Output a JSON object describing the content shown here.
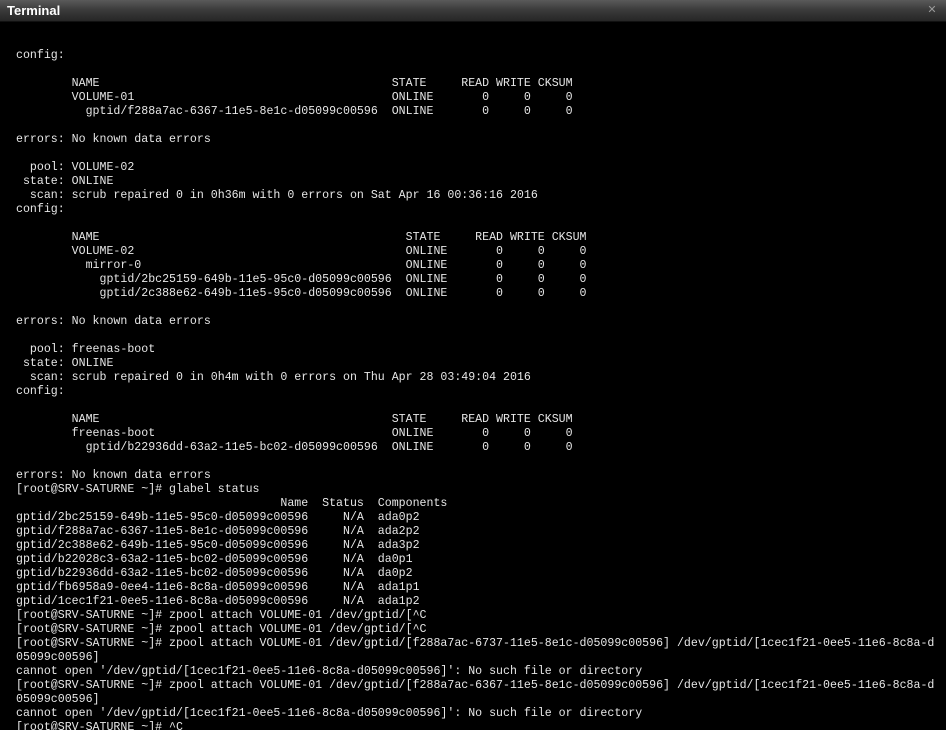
{
  "window": {
    "title": "Terminal",
    "close_icon": "close-icon",
    "colors": {
      "background": "#000000",
      "text": "#e6e6e6",
      "titlebar": "#3c3c3c"
    }
  },
  "terminal": {
    "lines": [
      "config:",
      "",
      "        NAME                                          STATE     READ WRITE CKSUM",
      "        VOLUME-01                                     ONLINE       0     0     0",
      "          gptid/f288a7ac-6367-11e5-8e1c-d05099c00596  ONLINE       0     0     0",
      "",
      "errors: No known data errors",
      "",
      "  pool: VOLUME-02",
      " state: ONLINE",
      "  scan: scrub repaired 0 in 0h36m with 0 errors on Sat Apr 16 00:36:16 2016",
      "config:",
      "",
      "        NAME                                            STATE     READ WRITE CKSUM",
      "        VOLUME-02                                       ONLINE       0     0     0",
      "          mirror-0                                      ONLINE       0     0     0",
      "            gptid/2bc25159-649b-11e5-95c0-d05099c00596  ONLINE       0     0     0",
      "            gptid/2c388e62-649b-11e5-95c0-d05099c00596  ONLINE       0     0     0",
      "",
      "errors: No known data errors",
      "",
      "  pool: freenas-boot",
      " state: ONLINE",
      "  scan: scrub repaired 0 in 0h4m with 0 errors on Thu Apr 28 03:49:04 2016",
      "config:",
      "",
      "        NAME                                          STATE     READ WRITE CKSUM",
      "        freenas-boot                                  ONLINE       0     0     0",
      "          gptid/b22936dd-63a2-11e5-bc02-d05099c00596  ONLINE       0     0     0",
      "",
      "errors: No known data errors",
      "[root@SRV-SATURNE ~]# glabel status",
      "                                      Name  Status  Components",
      "gptid/2bc25159-649b-11e5-95c0-d05099c00596     N/A  ada0p2",
      "gptid/f288a7ac-6367-11e5-8e1c-d05099c00596     N/A  ada2p2",
      "gptid/2c388e62-649b-11e5-95c0-d05099c00596     N/A  ada3p2",
      "gptid/b22028c3-63a2-11e5-bc02-d05099c00596     N/A  da0p1",
      "gptid/b22936dd-63a2-11e5-bc02-d05099c00596     N/A  da0p2",
      "gptid/fb6958a9-0ee4-11e6-8c8a-d05099c00596     N/A  ada1p1",
      "gptid/1cec1f21-0ee5-11e6-8c8a-d05099c00596     N/A  ada1p2",
      "[root@SRV-SATURNE ~]# zpool attach VOLUME-01 /dev/gptid/[^C",
      "[root@SRV-SATURNE ~]# zpool attach VOLUME-01 /dev/gptid/[^C",
      "[root@SRV-SATURNE ~]# zpool attach VOLUME-01 /dev/gptid/[f288a7ac-6737-11e5-8e1c-d05099c00596] /dev/gptid/[1cec1f21-0ee5-11e6-8c8a-d",
      "05099c00596]",
      "cannot open '/dev/gptid/[1cec1f21-0ee5-11e6-8c8a-d05099c00596]': No such file or directory",
      "[root@SRV-SATURNE ~]# zpool attach VOLUME-01 /dev/gptid/[f288a7ac-6367-11e5-8e1c-d05099c00596] /dev/gptid/[1cec1f21-0ee5-11e6-8c8a-d",
      "05099c00596]",
      "cannot open '/dev/gptid/[1cec1f21-0ee5-11e6-8c8a-d05099c00596]': No such file or directory",
      "[root@SRV-SATURNE ~]# ^C"
    ]
  }
}
